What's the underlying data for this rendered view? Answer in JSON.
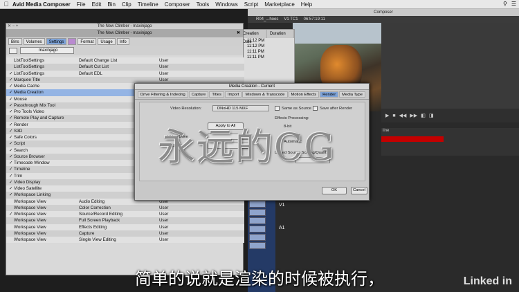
{
  "menubar": {
    "app": "Avid Media Composer",
    "items": [
      "File",
      "Edit",
      "Bin",
      "Clip",
      "Timeline",
      "Composer",
      "Tools",
      "Windows",
      "Script",
      "Marketplace",
      "Help"
    ]
  },
  "composer": {
    "title": "Composer",
    "clip": "R04_...hoes",
    "track": "V1 TC1",
    "timecode": "06:57:19:11",
    "timeline_label": "line",
    "tracks": [
      "V1",
      "A1"
    ]
  },
  "bin": {
    "columns": [
      "Creation Date",
      "Duration"
    ],
    "times": [
      "11:12 PM",
      "11:12 PM",
      "11:11 PM",
      "11:11 PM"
    ]
  },
  "settings": {
    "window_title": "The New Climber - maxinjago",
    "sub_title": "The New Climber - maxinjago",
    "tabs": [
      "Bins",
      "Volumes",
      "Settings",
      "Format",
      "Usage",
      "Info"
    ],
    "active_tab": "Settings",
    "user_select": "maxinjago",
    "rows": [
      {
        "check": "",
        "name": "ListToolSettings",
        "desc": "Default Change List",
        "kind": "User"
      },
      {
        "check": "",
        "name": "ListToolSettings",
        "desc": "Default Cut List",
        "kind": "User"
      },
      {
        "check": "✓",
        "name": "ListToolSettings",
        "desc": "Default EDL",
        "kind": "User"
      },
      {
        "check": "✓",
        "name": "Marquee Title",
        "desc": "",
        "kind": "User"
      },
      {
        "check": "✓",
        "name": "Media Cache",
        "desc": "",
        "kind": "User"
      },
      {
        "check": "✓",
        "name": "Media Creation",
        "desc": "",
        "kind": "User"
      },
      {
        "check": "✓",
        "name": "Mouse",
        "desc": "",
        "kind": "User"
      },
      {
        "check": "✓",
        "name": "Passthrough Mix Tool",
        "desc": "",
        "kind": "User"
      },
      {
        "check": "✓",
        "name": "Pro Tools Video",
        "desc": "",
        "kind": "User"
      },
      {
        "check": "✓",
        "name": "Remote Play and Capture",
        "desc": "",
        "kind": "User"
      },
      {
        "check": "✓",
        "name": "Render",
        "desc": "",
        "kind": "User"
      },
      {
        "check": "✓",
        "name": "S3D",
        "desc": "",
        "kind": "User"
      },
      {
        "check": "✓",
        "name": "Safe Colors",
        "desc": "",
        "kind": "User"
      },
      {
        "check": "✓",
        "name": "Script",
        "desc": "",
        "kind": "User"
      },
      {
        "check": "✓",
        "name": "Search",
        "desc": "",
        "kind": "User"
      },
      {
        "check": "✓",
        "name": "Source Browser",
        "desc": "",
        "kind": "User"
      },
      {
        "check": "✓",
        "name": "Timecode Window",
        "desc": "",
        "kind": "User"
      },
      {
        "check": "✓",
        "name": "Timeline",
        "desc": "",
        "kind": "User"
      },
      {
        "check": "✓",
        "name": "Trim",
        "desc": "",
        "kind": "User"
      },
      {
        "check": "✓",
        "name": "Video Display",
        "desc": "",
        "kind": "User"
      },
      {
        "check": "✓",
        "name": "Video Satellite",
        "desc": "",
        "kind": "User"
      },
      {
        "check": "✓",
        "name": "Workspace Linking",
        "desc": "",
        "kind": "User"
      },
      {
        "check": "",
        "name": "Workspace View",
        "desc": "Audio Editing",
        "kind": "User"
      },
      {
        "check": "",
        "name": "Workspace View",
        "desc": "Color Correction",
        "kind": "User"
      },
      {
        "check": "✓",
        "name": "Workspace View",
        "desc": "Source/Record Editing",
        "kind": "User"
      },
      {
        "check": "",
        "name": "Workspace View",
        "desc": "Full Screen Playback",
        "kind": "User"
      },
      {
        "check": "",
        "name": "Workspace View",
        "desc": "Effects Editing",
        "kind": "User"
      },
      {
        "check": "",
        "name": "Workspace View",
        "desc": "Capture",
        "kind": "User"
      },
      {
        "check": "",
        "name": "Workspace View",
        "desc": "Single View Editing",
        "kind": "User"
      }
    ]
  },
  "dialog": {
    "title": "Media Creation - Current",
    "tabs": [
      "Drive Filtering & Indexing",
      "Capture",
      "Titles",
      "Import",
      "Mixdown & Transcode",
      "Motion Effects",
      "Render",
      "Media Type"
    ],
    "active_tab": "Render",
    "video_resolution_label": "Video Resolution:",
    "video_resolution_value": "DNxHD 115 MXF",
    "same_as_source": "Same as Source",
    "save_after_render": "Save after Render",
    "effects_processing": "Effects Processing:",
    "opt_8bit": "8-bit",
    "opt_10bit": "10-bit",
    "opt_auto": "Automatic",
    "apply_to_all": "Apply to All",
    "video_drive_label": "Video Drive",
    "audio_drive_label": "Audio Drive",
    "linked_source": "Linked Source Scaling/Quality:",
    "ok": "OK",
    "cancel": "Cancel"
  },
  "watermark": "永远的CG",
  "subtitle": "简单的说就是渲染的时候被执行，",
  "logo": "Linked in"
}
